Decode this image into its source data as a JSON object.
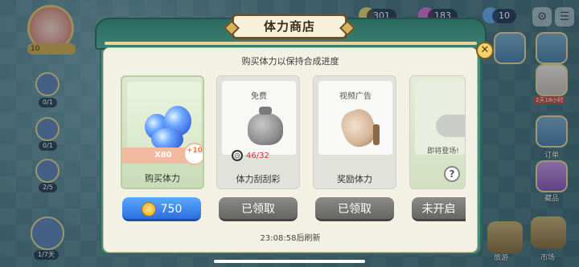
{
  "hud": {
    "player_level": "10",
    "resource1": "301",
    "resource2": "183",
    "resource3": "10"
  },
  "left_side": {
    "counters": [
      "0/1",
      "0/1",
      "2/5"
    ],
    "day_label": "1/7天"
  },
  "right_side": {
    "event_timer": "2天18小时",
    "order_label": "订单",
    "collection_label": "藏品",
    "travel_label": "旅游",
    "market_label": "市场"
  },
  "shop": {
    "title": "体力商店",
    "subtitle": "购买体力以保持合成进度",
    "refresh_text": "23:08:58后刷新",
    "cards": [
      {
        "tag": "",
        "name": "购买体力",
        "ribbon": "X80",
        "bonus": "+10",
        "button": "750"
      },
      {
        "tag": "免费",
        "name": "体力刮刮彩",
        "counter": "46/32",
        "button": "已领取"
      },
      {
        "tag": "视频广告",
        "name": "奖励体力",
        "button": "已领取"
      },
      {
        "tag": "即将登场!",
        "name": "",
        "button": "未开启"
      }
    ]
  },
  "colors": {
    "panel_frame": "#4a8a7c",
    "buy_button": "#2c6fe0",
    "claimed_button": "#666666"
  }
}
